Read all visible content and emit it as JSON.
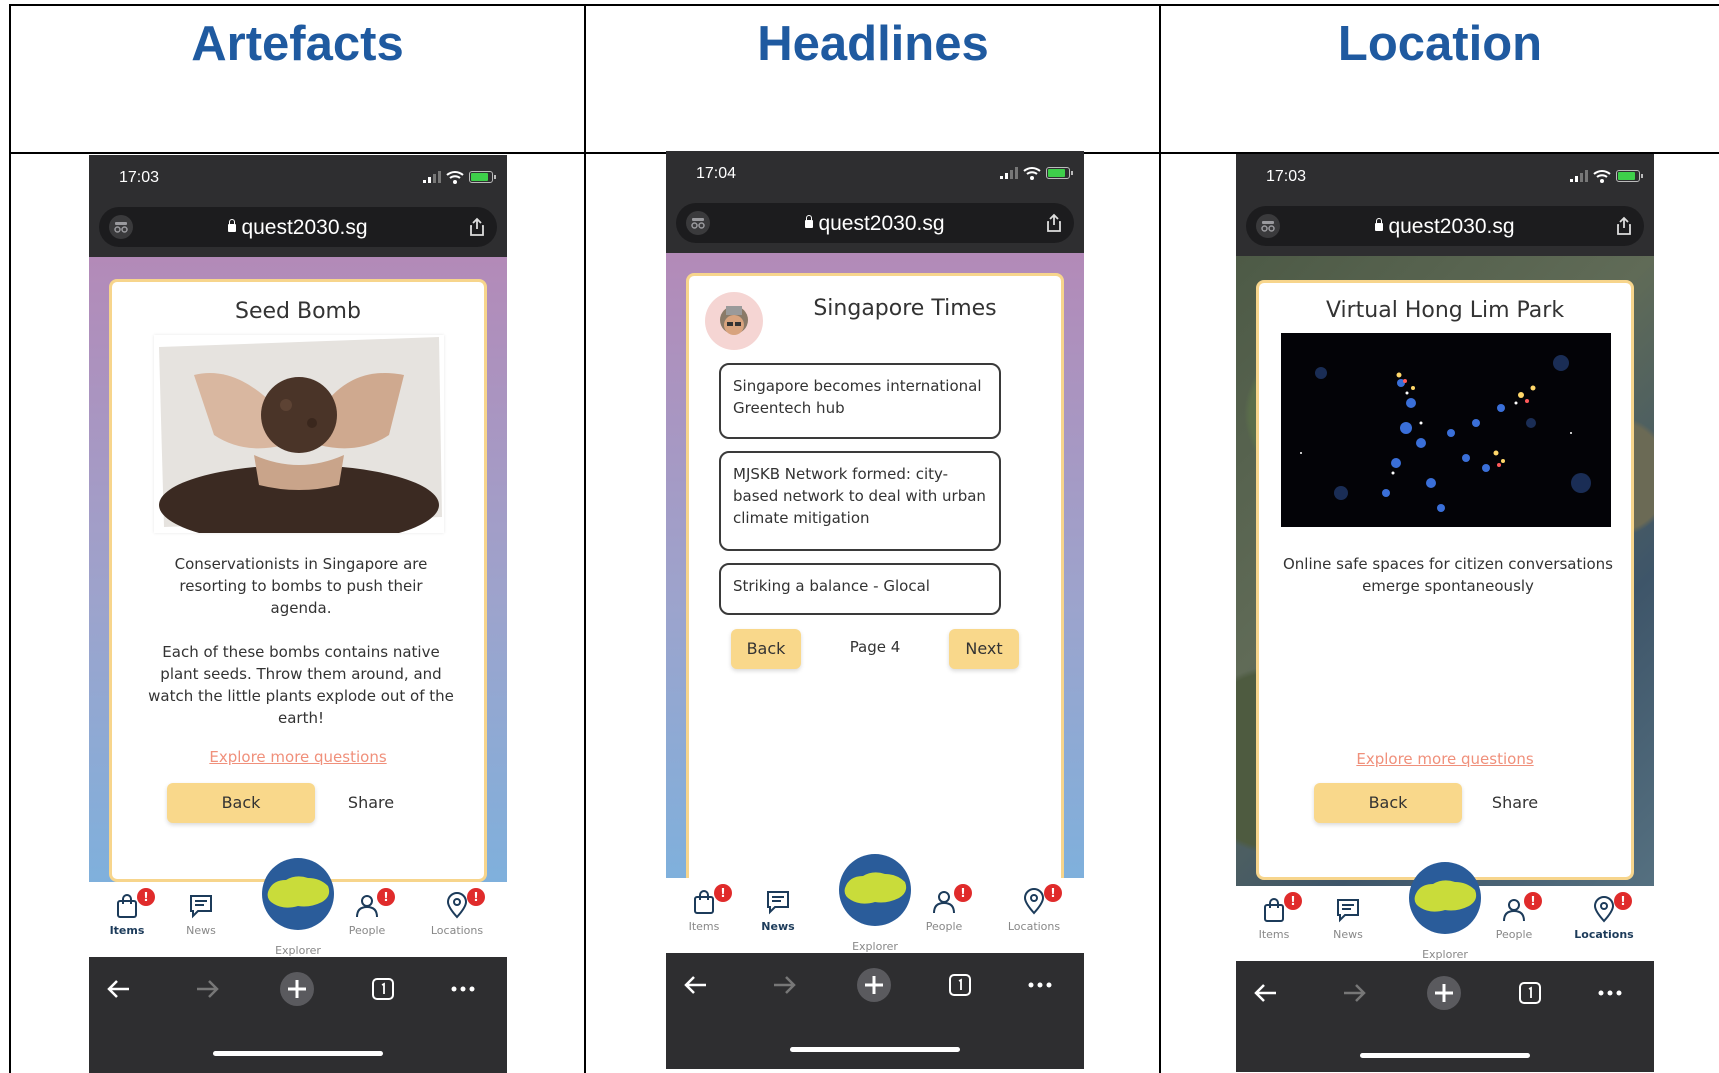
{
  "columns": [
    {
      "header": "Artefacts",
      "phone": {
        "time": "17:03",
        "url": "quest2030.sg",
        "card": {
          "title": "Seed Bomb",
          "image_alt": "hands holding a seed bomb",
          "description_1": "Conservationists in Singapore are resorting to bombs to push their agenda.",
          "description_2": "Each of these bombs contains native plant seeds. Throw them around, and watch the little plants explode out of the earth!",
          "link": "Explore more questions",
          "back": "Back",
          "share": "Share"
        },
        "nav": {
          "items": "Items",
          "news": "News",
          "explorer": "Explorer",
          "people": "People",
          "locations": "Locations",
          "active": "items"
        }
      }
    },
    {
      "header": "Headlines",
      "phone": {
        "time": "17:04",
        "url": "quest2030.sg",
        "card": {
          "title": "Singapore Times",
          "headlines": [
            "Singapore becomes international Greentech hub",
            "MJSKB Network formed: city-based network to deal with urban climate mitigation",
            "Striking a balance - Glocal"
          ],
          "back": "Back",
          "page": "Page 4",
          "next": "Next"
        },
        "nav": {
          "items": "Items",
          "news": "News",
          "explorer": "Explorer",
          "people": "People",
          "locations": "Locations",
          "active": "news"
        }
      }
    },
    {
      "header": "Location",
      "phone": {
        "time": "17:03",
        "url": "quest2030.sg",
        "card": {
          "title": "Virtual Hong Lim Park",
          "description": "Online safe spaces for citizen conversations emerge spontaneously",
          "link": "Explore more questions",
          "back": "Back",
          "share": "Share"
        },
        "nav": {
          "items": "Items",
          "news": "News",
          "explorer": "Explorer",
          "people": "People",
          "locations": "Locations",
          "active": "locations"
        }
      }
    }
  ],
  "badge_text": "!",
  "colors": {
    "header_blue": "#1f5aa0",
    "card_border": "#f7d58c",
    "button_yellow": "#f9d88b",
    "link_coral": "#f0907b",
    "badge_red": "#e02b2b",
    "explorer_blue": "#2a5c9a"
  }
}
